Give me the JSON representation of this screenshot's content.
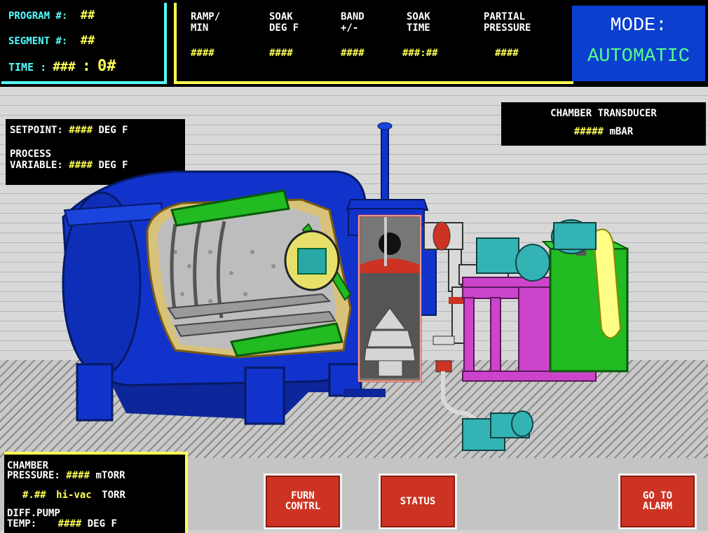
{
  "program": {
    "program_label": "PROGRAM #:",
    "program_value": "##",
    "segment_label": "SEGMENT #:",
    "segment_value": "##",
    "time_label": "TIME :",
    "time_hours": "###",
    "time_sep": ":",
    "time_minutes": "0#"
  },
  "segment_params": [
    {
      "label_line1": "RAMP/",
      "label_line2": "MIN",
      "value": "####"
    },
    {
      "label_line1": "SOAK",
      "label_line2": "DEG F",
      "value": "####"
    },
    {
      "label_line1": "BAND",
      "label_line2": "+/-",
      "value": "####"
    },
    {
      "label_line1": "SOAK",
      "label_line2": "TIME",
      "value": "###:##"
    },
    {
      "label_line1": "PARTIAL",
      "label_line2": "PRESSURE",
      "value": "####"
    }
  ],
  "mode": {
    "label": "MODE:",
    "value": "AUTOMATIC"
  },
  "setpoint": {
    "setpoint_label": "SETPOINT:",
    "setpoint_value": "####",
    "setpoint_unit": "DEG F",
    "process_label_line1": "PROCESS",
    "process_label_line2": "VARIABLE:",
    "process_value": "####",
    "process_unit": "DEG F"
  },
  "chamber_transducer": {
    "title": "CHAMBER TRANSDUCER",
    "value": "#####",
    "unit": "mBAR"
  },
  "chamber_pressure": {
    "label_line1": "CHAMBER",
    "label_line2": "PRESSURE:",
    "mtorr_value": "####",
    "mtorr_unit": "mTORR",
    "hivac_value": "#.##",
    "hivac_label": "hi-vac",
    "hivac_unit": "TORR",
    "diff_label_line1": "DIFF.PUMP",
    "diff_label_line2": "TEMP:",
    "diff_value": "####",
    "diff_unit": "DEG F"
  },
  "buttons": {
    "furn_line1": "FURN",
    "furn_line2": "CONTRL",
    "status": "STATUS",
    "alarm_line1": "GO TO",
    "alarm_line2": "ALARM"
  },
  "colors": {
    "panel_border_cyan": "#55ffff",
    "panel_border_yellow": "#ffff55",
    "mode_bg": "#0b3fd0",
    "mode_value": "#55ff88",
    "button_red": "#cc3322",
    "vessel_blue": "#1133cc",
    "pump_green": "#22bb22",
    "frame_magenta": "#cc44cc",
    "motor_teal": "#33b3b3"
  }
}
